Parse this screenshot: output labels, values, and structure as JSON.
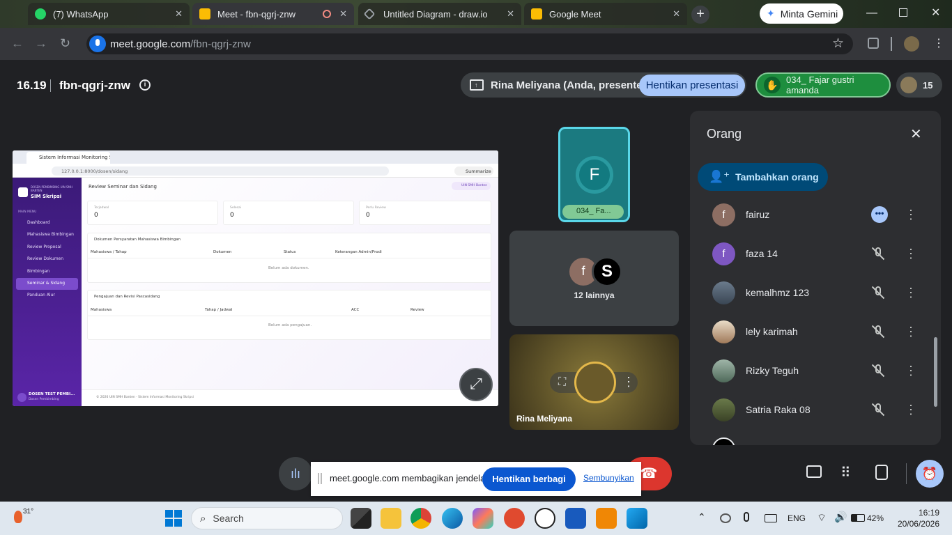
{
  "browser": {
    "tabs": [
      {
        "label": "(7) WhatsApp",
        "color": "#25d366"
      },
      {
        "label": "Meet - fbn-qgrj-znw",
        "color": "#fbbc04"
      },
      {
        "label": "Untitled Diagram - draw.io",
        "color": "#f08705"
      },
      {
        "label": "Google Meet",
        "color": "#fbbc04"
      }
    ],
    "gemini_button": "Minta Gemini",
    "url_host": "meet.google.com",
    "url_path": "/fbn-qgrj-znw"
  },
  "meet": {
    "time": "16.19",
    "code": "fbn-qgrj-znw",
    "presenter_label": "Rina Meliyana (Anda, presenter)",
    "stop_presenting": "Hentikan presentasi",
    "raised_hand": "034_ Fajar gustri amanda",
    "participant_count": "15",
    "tile_f_initial": "F",
    "tile_f_name": "034_ Fa...",
    "others_label": "12 lainnya",
    "self_name": "Rina Meliyana",
    "share_banner": "meet.google.com membagikan jendela.",
    "stop_sharing": "Hentikan berbagi",
    "hide": "Sembunyikan"
  },
  "people_panel": {
    "title": "Orang",
    "add_button": "Tambahkan orang",
    "list": [
      {
        "name": "fairuz",
        "initial": "f",
        "color": "#8d6e63"
      },
      {
        "name": "faza 14",
        "initial": "f",
        "color": "#7e57c2"
      },
      {
        "name": "kemalhmz 123",
        "initial": "",
        "color": "#5c6b7a"
      },
      {
        "name": "lely karimah",
        "initial": "",
        "color": "#b39a7a"
      },
      {
        "name": "Rizky Teguh",
        "initial": "",
        "color": "#6f8a7a"
      },
      {
        "name": "Satria Raka 08",
        "initial": "",
        "color": "#4e5a3e"
      }
    ]
  },
  "shared_app": {
    "tab_title": "Sistem Informasi Monitoring Skrip",
    "url": "127.0.0.1:8000/dosen/sidang",
    "profile": "Summarize",
    "brand_small": "DOSEN PEMBIMBING UIN SMH BANTEN",
    "brand": "SIM Skripsi",
    "menu_header": "MAIN MENU",
    "menu": [
      "Dashboard",
      "Mahasiswa Bimbingan",
      "Review Proposal",
      "Review Dokumen",
      "Bimbingan",
      "Seminar & Sidang",
      "Panduan Alur"
    ],
    "page_title": "Review Seminar dan Sidang",
    "badge": "UIN SMH Banten",
    "stats": [
      {
        "label": "Terjadwal",
        "value": "0"
      },
      {
        "label": "Selesai",
        "value": "0"
      },
      {
        "label": "Perlu Review",
        "value": "0"
      }
    ],
    "section1": "Dokumen Persyaratan Mahasiswa Bimbingan",
    "table1_headers": [
      "Mahasiswa / Tahap",
      "Dokumen",
      "Status",
      "Keterangan Admin/Prodi"
    ],
    "table1_empty": "Belum ada dokumen.",
    "section2": "Pengajuan dan Revisi Pascasidang",
    "table2_headers": [
      "Mahasiswa",
      "Tahap / Jadwal",
      "ACC",
      "Review"
    ],
    "table2_empty": "Belum ada pengajuan.",
    "user_name": "DOSEN TEST PEMBI...",
    "user_role": "Dosen Pembimbing",
    "footer": "© 2026 UIN SMH Banten · Sistem Informasi Monitoring Skripsi"
  },
  "taskbar": {
    "weather": "31°",
    "search": "Search",
    "lang": "ENG",
    "battery": "42%",
    "time": "16:19",
    "date": "20/06/2026"
  }
}
